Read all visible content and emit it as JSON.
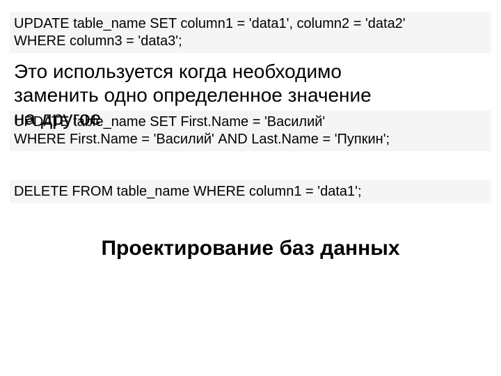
{
  "code1": {
    "line1": "UPDATE table_name SET column1 = 'data1', column2 = 'data2'",
    "line2": "WHERE column3 = 'data3';"
  },
  "body": {
    "line1": "Это используется когда необходимо",
    "line2": "заменить одно определенное значение",
    "line3": "на другое"
  },
  "code2": {
    "line1": "UPDATE table_name SET First.Name = 'Василий'",
    "line2": "WHERE First.Name = 'Василий' AND Last.Name = 'Пупкин';"
  },
  "code3": {
    "line1": "DELETE FROM table_name WHERE column1 = 'data1';"
  },
  "heading": "Проектирование баз данных"
}
